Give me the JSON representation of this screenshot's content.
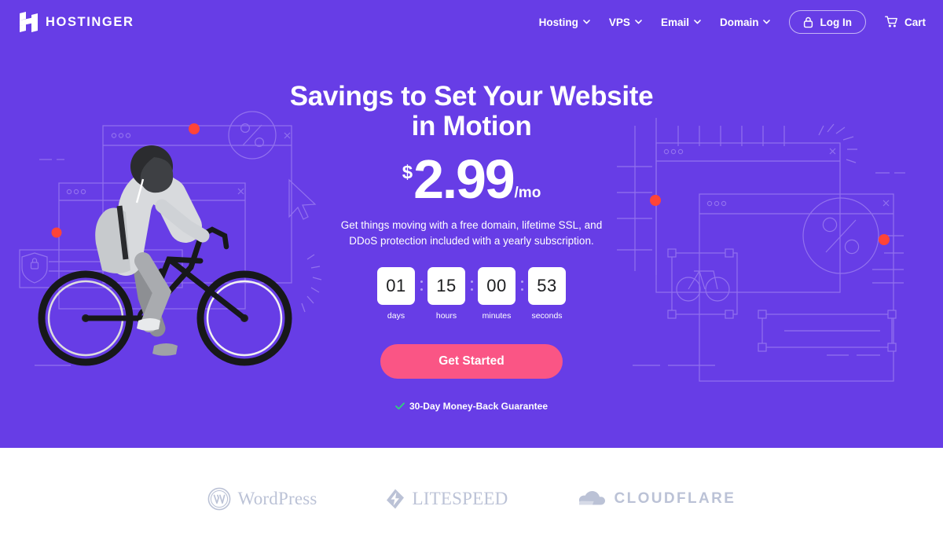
{
  "brand": {
    "name": "HOSTINGER",
    "logo_icon": "hostinger-h-mark"
  },
  "nav": {
    "items": [
      {
        "label": "Hosting",
        "caret_icon": "chevron-down-icon"
      },
      {
        "label": "VPS",
        "caret_icon": "chevron-down-icon"
      },
      {
        "label": "Email",
        "caret_icon": "chevron-down-icon"
      },
      {
        "label": "Domain",
        "caret_icon": "chevron-down-icon"
      }
    ],
    "login": {
      "label": "Log In",
      "icon": "lock-icon"
    },
    "cart": {
      "label": "Cart",
      "icon": "shopping-cart-icon"
    }
  },
  "hero": {
    "headline": "Savings to Set Your Website in Motion",
    "price": {
      "currency": "$",
      "amount": "2.99",
      "period": "/mo"
    },
    "subtitle": "Get things moving with a free domain, lifetime SSL, and DDoS protection included with a yearly subscription.",
    "cta_label": "Get Started",
    "guarantee": {
      "icon": "check-icon",
      "text": "30-Day Money-Back Guarantee"
    },
    "countdown": {
      "separator": ":",
      "units": [
        {
          "value": "01",
          "label": "days"
        },
        {
          "value": "15",
          "label": "hours"
        },
        {
          "value": "00",
          "label": "minutes"
        },
        {
          "value": "53",
          "label": "seconds"
        }
      ]
    }
  },
  "partners": [
    {
      "name": "WordPress",
      "icon": "wordpress-logo-icon"
    },
    {
      "name": "LITESPEED",
      "icon": "litespeed-logo-icon"
    },
    {
      "name": "CLOUDFLARE",
      "icon": "cloudflare-logo-icon"
    }
  ],
  "colors": {
    "hero_background": "#673DE6",
    "cta_background": "#FA5585",
    "accent_dot": "#FF4438",
    "check_green": "#2ED47A",
    "partner_gray": "#B8BFD4",
    "text_light": "#FFFFFF"
  }
}
